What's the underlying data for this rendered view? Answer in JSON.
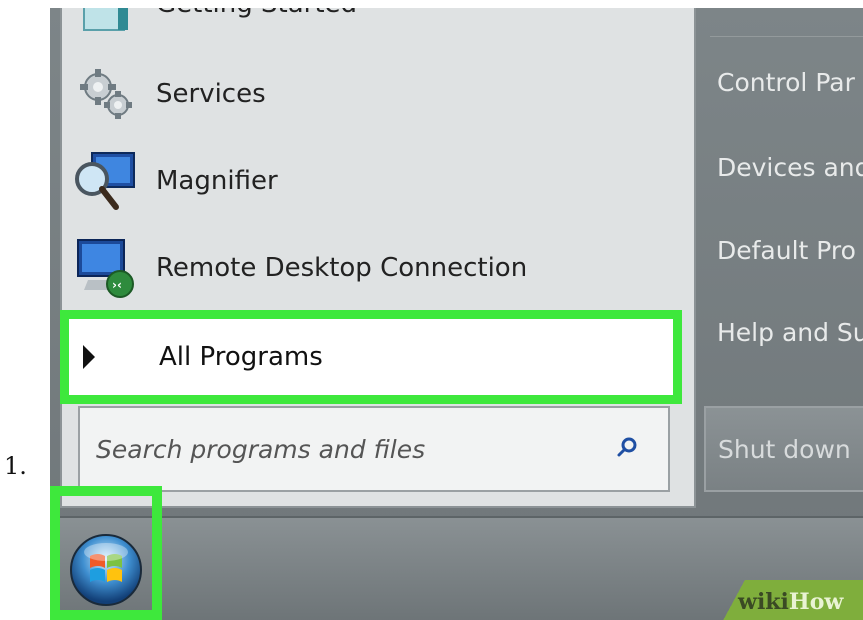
{
  "step_number": "1.",
  "programs": [
    {
      "label": "Getting Started",
      "icon": "getting-started-icon"
    },
    {
      "label": "Services",
      "icon": "services-gear-icon"
    },
    {
      "label": "Magnifier",
      "icon": "magnifier-icon"
    },
    {
      "label": "Remote Desktop Connection",
      "icon": "remote-desktop-icon"
    }
  ],
  "all_programs": {
    "label": "All Programs",
    "icon": "triangle-right-icon"
  },
  "search": {
    "placeholder": "Search programs and files",
    "icon": "search-icon"
  },
  "right_pane": {
    "items": [
      "Control Par",
      "Devices and",
      "Default Pro",
      "Help and Su"
    ],
    "shutdown_label": "Shut down"
  },
  "highlight_color": "#3ee83c",
  "watermark": {
    "prefix": "wiki",
    "suffix": "How"
  }
}
